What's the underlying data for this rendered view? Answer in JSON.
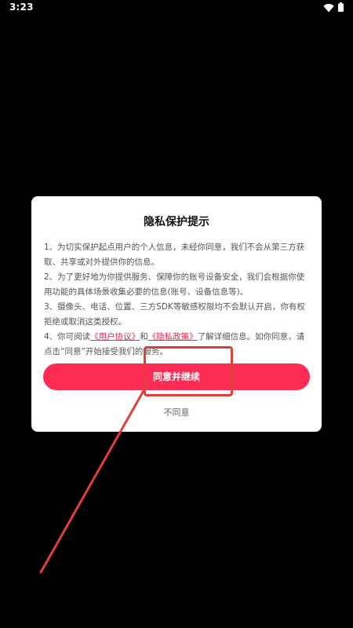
{
  "status_bar": {
    "time": "3:23"
  },
  "dialog": {
    "title": "隐私保护提示",
    "items": [
      {
        "text": "1、为切实保护起点用户的个人信息，未经你同意，我们不会从第三方获取、共享或对外提供你的信息。"
      },
      {
        "text": "2、为了更好地为你提供服务、保障你的账号设备安全，我们会根据你使用功能的具体场景收集必要的信息(账号、设备信息等)。"
      },
      {
        "text": "3、摄像头、电话、位置、三方SDK等敏感权限均不会默认开启，你有权拒绝或取消这类授权。"
      }
    ],
    "item4": {
      "prefix": "4、你可阅读",
      "user_agreement": "《用户协议》",
      "and": "和",
      "privacy_policy": "《隐私政策》",
      "suffix": "了解详细信息。如你同意，请点击“同意”开始接受我们的服务。"
    },
    "agree_button": "同意并继续",
    "disagree": "不同意"
  },
  "colors": {
    "accent": "#fe2c55",
    "link": "#e8294a",
    "annotation": "#e0403a",
    "background": "#000000"
  },
  "icons": {
    "wifi": "wifi-icon",
    "battery": "battery-icon"
  }
}
